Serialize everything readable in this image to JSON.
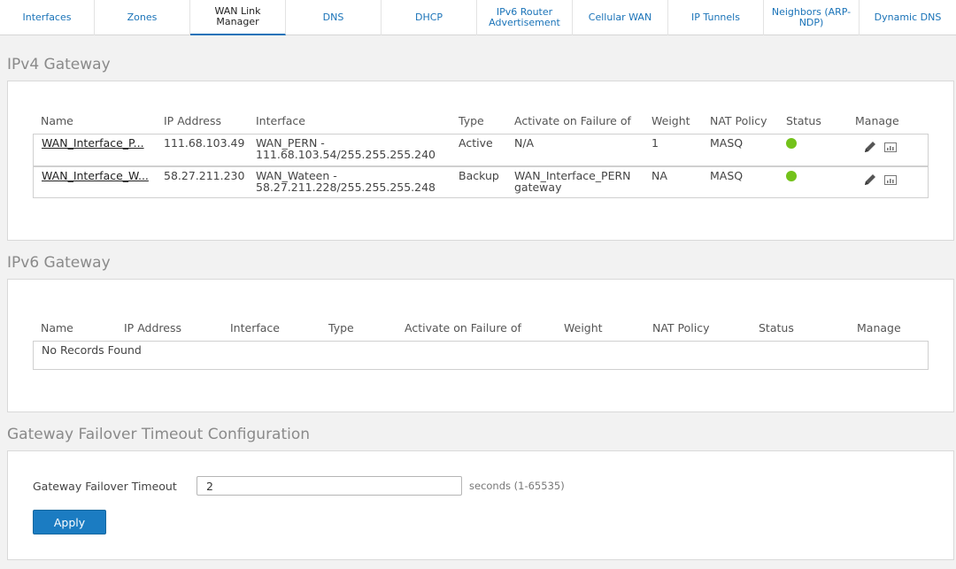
{
  "tabs": [
    {
      "label": "Interfaces"
    },
    {
      "label": "Zones"
    },
    {
      "label": "WAN Link Manager"
    },
    {
      "label": "DNS"
    },
    {
      "label": "DHCP"
    },
    {
      "label": "IPv6 Router Advertisement"
    },
    {
      "label": "Cellular WAN"
    },
    {
      "label": "IP Tunnels"
    },
    {
      "label": "Neighbors (ARP-NDP)"
    },
    {
      "label": "Dynamic DNS"
    }
  ],
  "ipv4": {
    "title": "IPv4 Gateway",
    "headers": [
      "Name",
      "IP Address",
      "Interface",
      "Type",
      "Activate on Failure of",
      "Weight",
      "NAT Policy",
      "Status",
      "Manage"
    ],
    "rows": [
      {
        "name": "WAN_Interface_P...",
        "ip": "111.68.103.49",
        "interface_line1": "WAN_PERN -",
        "interface_line2": "111.68.103.54/255.255.255.240",
        "type": "Active",
        "failure_line1": "N/A",
        "failure_line2": "",
        "weight": "1",
        "nat": "MASQ",
        "status_color": "#73c21a"
      },
      {
        "name": "WAN_Interface_W...",
        "ip": "58.27.211.230",
        "interface_line1": "WAN_Wateen -",
        "interface_line2": "58.27.211.228/255.255.255.248",
        "type": "Backup",
        "failure_line1": "WAN_Interface_PERN",
        "failure_line2": "gateway",
        "weight": "NA",
        "nat": "MASQ",
        "status_color": "#73c21a"
      }
    ]
  },
  "ipv6": {
    "title": "IPv6 Gateway",
    "headers": [
      "Name",
      "IP Address",
      "Interface",
      "Type",
      "Activate on Failure of",
      "Weight",
      "NAT Policy",
      "Status",
      "Manage"
    ],
    "empty_text": "No Records Found"
  },
  "failover": {
    "title": "Gateway Failover Timeout Configuration",
    "label": "Gateway Failover Timeout",
    "value": "2",
    "hint": "seconds (1-65535)",
    "apply_label": "Apply"
  },
  "icons": {
    "edit": "pencil-icon",
    "chart": "chart-icon",
    "status": "status-dot"
  },
  "colors": {
    "accent": "#1a73b8",
    "button": "#1b7cc2",
    "status_ok": "#73c21a"
  }
}
